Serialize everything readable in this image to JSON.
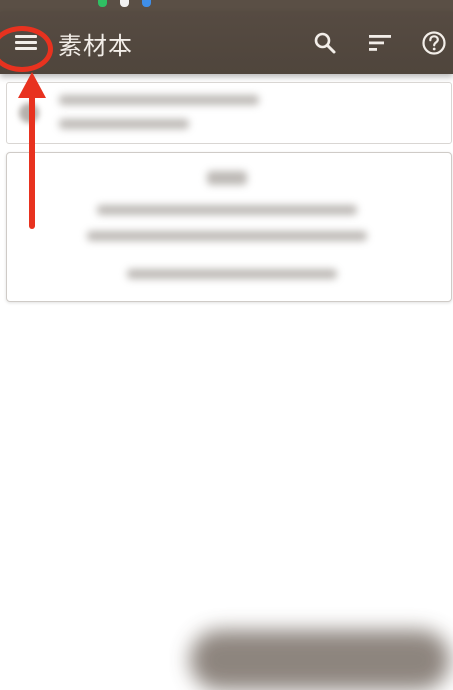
{
  "app_bar": {
    "title": "素材本",
    "background_color": "#564b42",
    "icons": [
      "menu-icon",
      "search-icon",
      "sort-icon",
      "help-icon"
    ]
  },
  "annotation": {
    "color": "#e8321f",
    "highlight": "menu-icon"
  }
}
